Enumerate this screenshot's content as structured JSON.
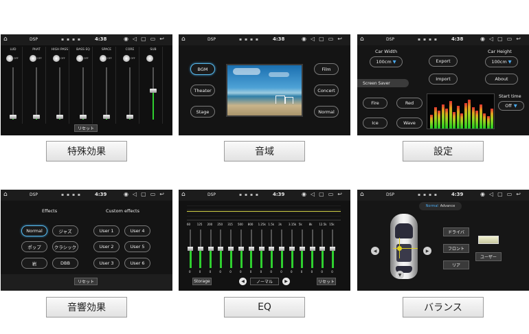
{
  "statusbar": {
    "title": "DSP",
    "time1": "4:38",
    "time2": "4:39"
  },
  "captions": {
    "dsp": "特殊効果",
    "sound_field": "音域",
    "settings": "設定",
    "sound_effects": "音響効果",
    "eq": "EQ",
    "balance": "バランス"
  },
  "dsp": {
    "channels": [
      {
        "name": "LUD",
        "state": "OFF",
        "level": 0.05
      },
      {
        "name": "PHAT",
        "state": "OFF",
        "level": 0.05
      },
      {
        "name": "HIGH PASS",
        "state": "OFF",
        "level": 0.05
      },
      {
        "name": "BASS EQ",
        "state": "OFF",
        "level": 0.05
      },
      {
        "name": "SPACE",
        "state": "OFF",
        "level": 0.05
      },
      {
        "name": "CORE",
        "state": "OFF",
        "level": 0.05
      },
      {
        "name": "SUB",
        "state": "",
        "level": 0.55
      }
    ],
    "reset": "リセット"
  },
  "sound_field": {
    "left": [
      "BGM",
      "Theater",
      "Stage"
    ],
    "right": [
      "Film",
      "Concert",
      "Normal"
    ],
    "selected": "BGM"
  },
  "settings": {
    "car_width_label": "Car Width",
    "car_width_value": "100cm",
    "car_height_label": "Car Height",
    "car_height_value": "100cm",
    "export": "Export",
    "import": "Import",
    "about": "About",
    "screen_saver": "Screen Saver",
    "savers": [
      "Fire",
      "Red",
      "Ice",
      "Wave"
    ],
    "start_time_label": "Start time",
    "start_time_value": "Off",
    "spectrum": [
      0.45,
      0.7,
      0.6,
      0.8,
      0.65,
      0.9,
      0.55,
      0.75,
      0.5,
      0.85,
      0.95,
      0.7,
      0.6,
      0.8,
      0.5,
      0.4,
      0.65
    ]
  },
  "sound_effects": {
    "effects_title": "Effects",
    "custom_title": "Custom effects",
    "effects": [
      "Normal",
      "ジャズ",
      "ポップ",
      "クラシック",
      "岩",
      "DBB"
    ],
    "custom": [
      "User 1",
      "User 4",
      "User 2",
      "User 5",
      "User 3",
      "User 6"
    ],
    "selected": "Normal",
    "reset": "リセット"
  },
  "eq": {
    "freqs": [
      "60",
      "125",
      "200",
      "250",
      "315",
      "500",
      "800",
      "1.25k",
      "1.5k",
      "2k",
      "3.15k",
      "5k",
      "8k",
      "12.5k",
      "15k"
    ],
    "values": [
      0,
      0,
      0,
      0,
      0,
      0,
      0,
      0,
      0,
      0,
      0,
      0,
      0,
      0,
      0
    ],
    "storage": "Storage",
    "preset": "ノーマル",
    "reset": "リセット"
  },
  "balance": {
    "tab_normal": "Normal",
    "tab_advance": "Advance",
    "driver": "ドライバ",
    "front": "フロント",
    "rear": "リア",
    "user": "ユーザー"
  }
}
